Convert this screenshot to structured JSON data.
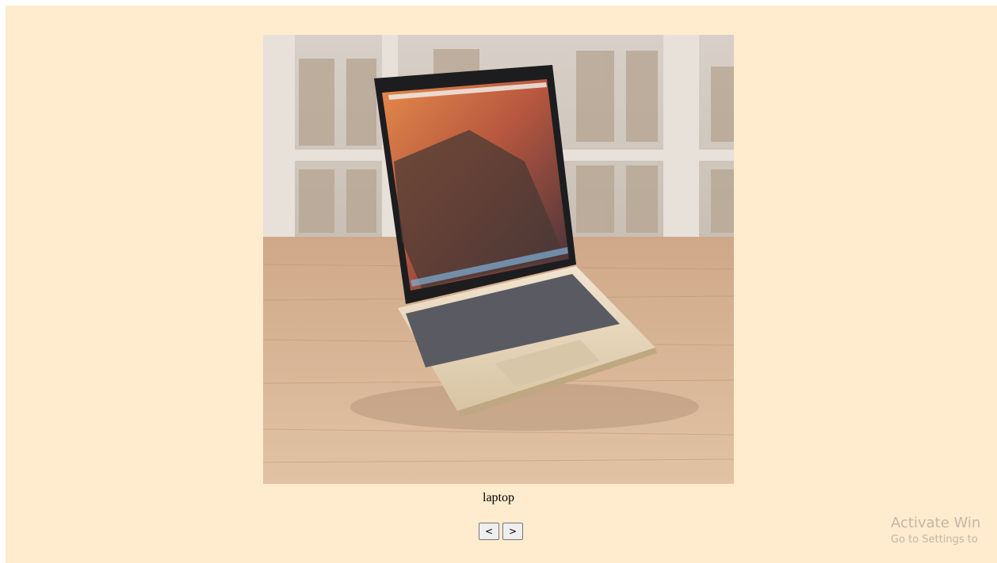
{
  "slideshow": {
    "image_alt": "laptop",
    "caption": "laptop",
    "prev_label": "<",
    "next_label": ">"
  },
  "watermark": {
    "title": "Activate Win",
    "subtitle": "Go to Settings to"
  },
  "colors": {
    "page_background": "#ffebcd",
    "button_background": "#efefef",
    "button_border": "#767676"
  }
}
